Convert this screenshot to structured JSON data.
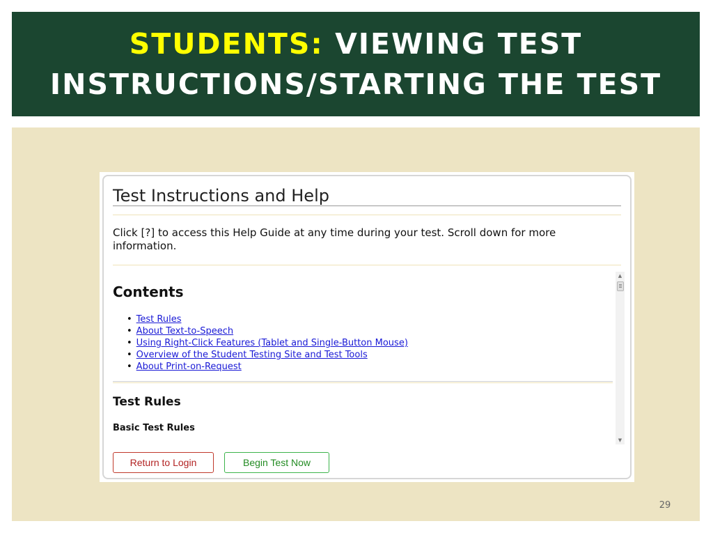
{
  "slide": {
    "title_accent": "STUDENTS:",
    "title_rest_line1": "VIEWING TEST",
    "title_line2": "INSTRUCTIONS/STARTING THE TEST",
    "slide_number": "29"
  },
  "help_panel": {
    "title": "Test Instructions and Help",
    "intro_line1": "Click [?] to access this Help Guide at any time during your test. Scroll down for more",
    "intro_line2": "information.",
    "contents_heading": "Contents",
    "contents_links": [
      "Test Rules",
      "About Text-to-Speech",
      "Using Right-Click Features (Tablet and Single-Button Mouse)",
      "Overview of the Student Testing Site and Test Tools",
      "About Print-on-Request"
    ],
    "section_heading": "Test Rules",
    "subsection_heading": "Basic Test Rules"
  },
  "buttons": {
    "return_label": "Return to Login",
    "begin_label": "Begin Test Now"
  },
  "icons": {
    "scroll_up": "scroll-up-arrow",
    "scroll_down": "scroll-down-arrow",
    "scroll_thumb": "scrollbar-thumb"
  },
  "colors": {
    "title_bar": "#1b4630",
    "title_accent": "#ffff00",
    "content_bg": "#ede4c3",
    "link": "#1a1ad6",
    "return_button": "#b22222",
    "begin_button": "#228b22"
  }
}
